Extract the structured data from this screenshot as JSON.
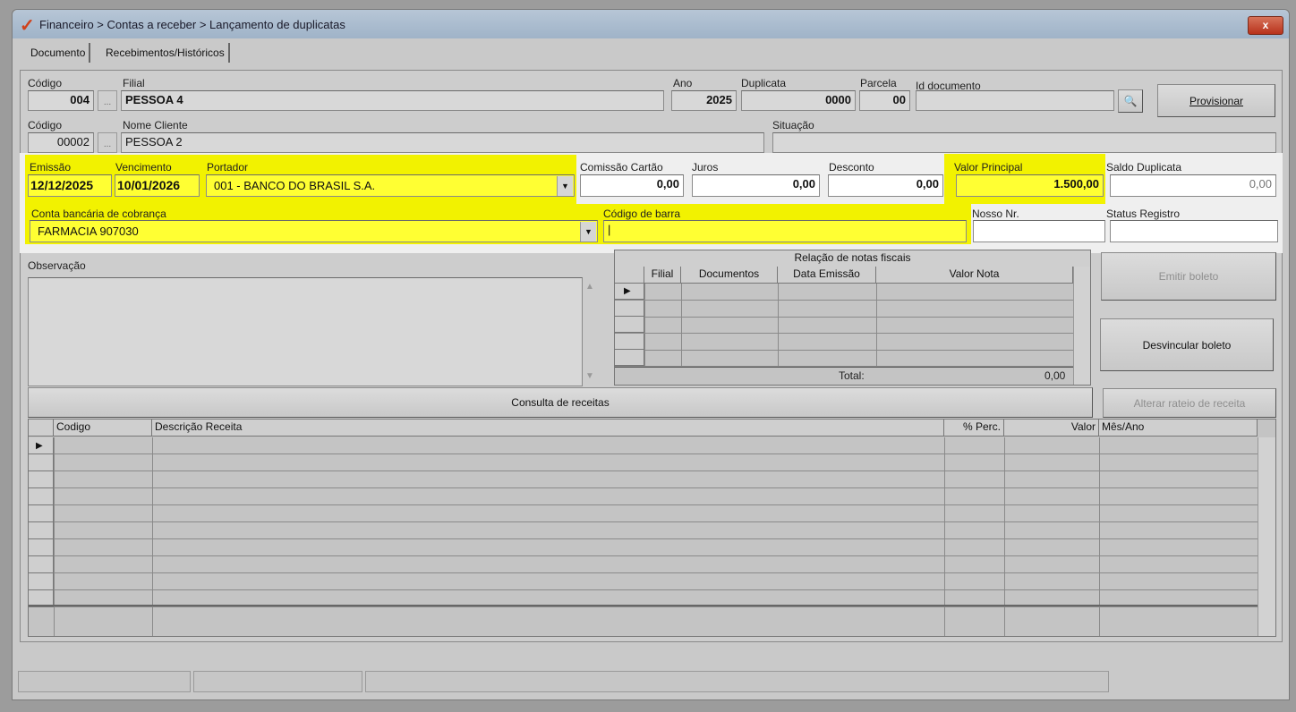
{
  "window": {
    "title": "Financeiro > Contas a receber > Lançamento de duplicatas",
    "close_label": "x"
  },
  "tabs": [
    {
      "label": "Documento"
    },
    {
      "label": "Recebimentos/Históricos"
    }
  ],
  "header": {
    "codigo_filial_label": "Código",
    "codigo_filial": "004",
    "filial_label": "Filial",
    "filial": "PESSOA 4",
    "ano_label": "Ano",
    "ano": "2025",
    "duplicata_label": "Duplicata",
    "duplicata": "0000",
    "parcela_label": "Parcela",
    "parcela": "00",
    "id_documento_label": "Id documento",
    "id_documento": "",
    "provisionar_label": "Provisionar",
    "codigo_cliente_label": "Código",
    "codigo_cliente": "00002",
    "nome_cliente_label": "Nome Cliente",
    "nome_cliente": "PESSOA 2",
    "situacao_label": "Situação",
    "situacao": "",
    "dots": "..."
  },
  "values": {
    "emissao_label": "Emissão",
    "emissao": "12/12/2025",
    "vencimento_label": "Vencimento",
    "vencimento": "10/01/2026",
    "portador_label": "Portador",
    "portador": "001 - BANCO DO BRASIL S.A.",
    "comissao_label": "Comissão Cartão",
    "comissao": "0,00",
    "juros_label": "Juros",
    "juros": "0,00",
    "desconto_label": "Desconto",
    "desconto": "0,00",
    "valor_principal_label": "Valor Principal",
    "valor_principal": "1.500,00",
    "saldo_label": "Saldo Duplicata",
    "saldo": "0,00",
    "conta_label": "Conta bancária de cobrança",
    "conta": "FARMACIA 907030",
    "codigo_barra_label": "Código de barra",
    "codigo_barra": "|",
    "nosso_nr_label": "Nosso Nr.",
    "nosso_nr": "",
    "status_registro_label": "Status Registro",
    "status_registro": ""
  },
  "observacao": {
    "label": "Observação",
    "value": ""
  },
  "notas": {
    "title": "Relação de notas fiscais",
    "columns": [
      "Filial",
      "Documentos",
      "Data Emissão",
      "Valor Nota"
    ],
    "total_label": "Total:",
    "total": "0,00"
  },
  "buttons": {
    "emitir_boleto": "Emitir boleto",
    "desvincular_boleto": "Desvincular boleto",
    "alterar_rateio": "Alterar rateio de receita",
    "consulta_receitas": "Consulta de receitas"
  },
  "receitas": {
    "columns": [
      "Codigo",
      "Descrição Receita",
      "% Perc.",
      "Valor",
      "Mês/Ano"
    ]
  },
  "colors": {
    "highlight": "#ffff33",
    "title_bar": "#a8bcd0"
  }
}
